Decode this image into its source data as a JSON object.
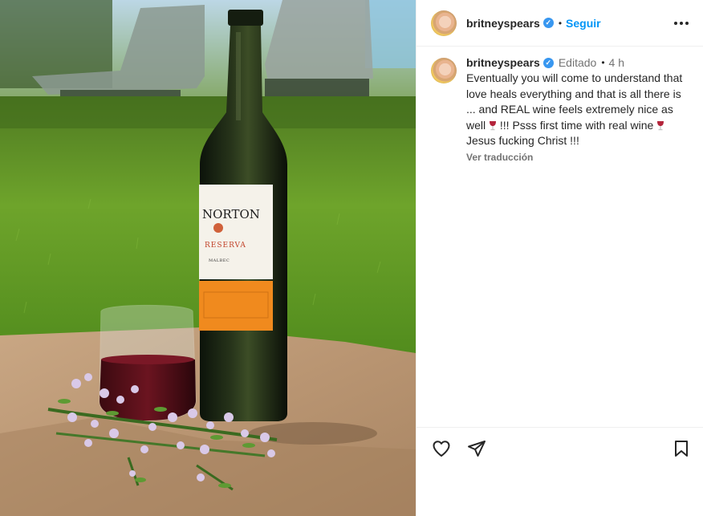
{
  "post": {
    "author": {
      "username": "britneyspears",
      "verified": true,
      "avatar_icon": "profile-avatar"
    },
    "header": {
      "separator": "•",
      "follow_label": "Seguir",
      "more_icon": "more-options-icon"
    },
    "comment": {
      "edited_label": "Editado",
      "separator": "•",
      "time": "4 h",
      "caption_part1": "Eventually you will come to understand that love heals everything and that is all there is ... and REAL wine feels extremely nice as well",
      "caption_part2": "!!! Psss first time with real wine",
      "caption_part3": "Jesus fucking Christ !!!",
      "emoji_icon": "wine-glass-emoji",
      "translate_label": "Ver traducción"
    },
    "actions": {
      "like_icon": "heart-icon",
      "share_icon": "paper-plane-icon",
      "save_icon": "bookmark-icon"
    },
    "photo": {
      "bottle_label": {
        "brand": "NORTON",
        "line": "RESERVA",
        "varietal": "MALBEC"
      }
    },
    "colors": {
      "follow": "#0095f6",
      "verified": "#3897f0",
      "text": "#262626",
      "muted": "#737373",
      "bottle_band": "#f08a1e"
    }
  }
}
